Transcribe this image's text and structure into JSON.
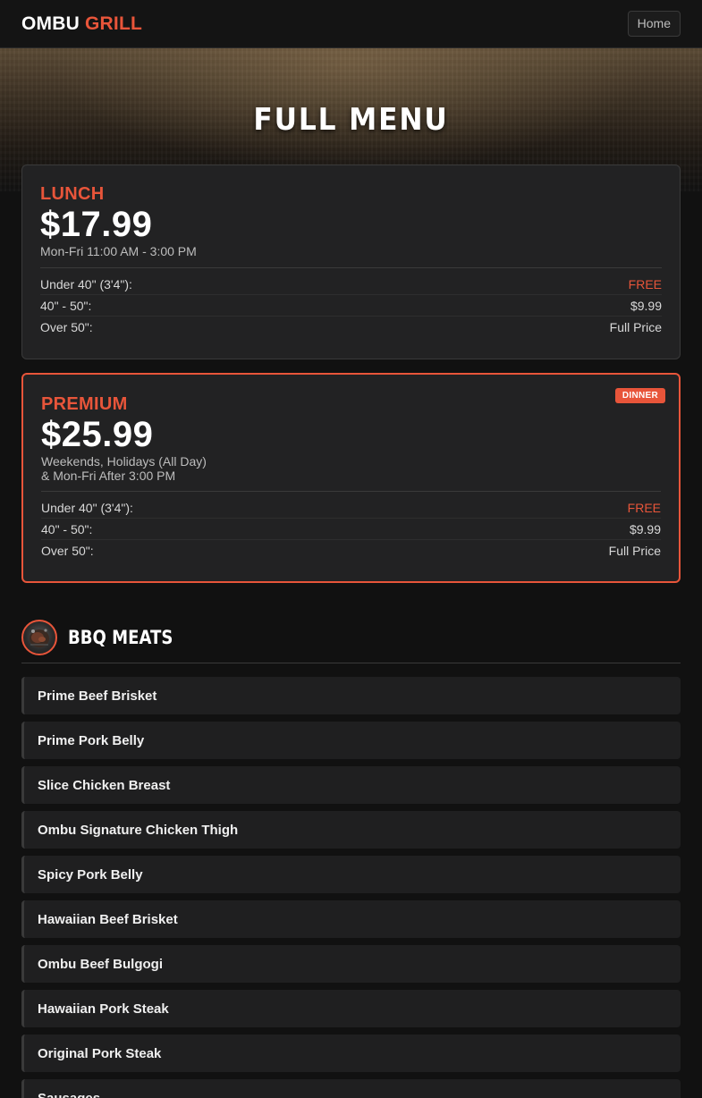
{
  "header": {
    "brand_main": "OMBU",
    "brand_accent": "GRILL",
    "home_label": "Home"
  },
  "hero": {
    "title": "FULL MENU"
  },
  "pricing": {
    "lunch": {
      "label": "LUNCH",
      "price": "$17.99",
      "hours": "Mon-Fri 11:00 AM - 3:00 PM",
      "rows": [
        {
          "label": "Under 40\" (3'4\"):",
          "value": "FREE"
        },
        {
          "label": "40\" - 50\":",
          "value": "$9.99"
        },
        {
          "label": "Over 50\":",
          "value": "Full Price"
        }
      ]
    },
    "premium": {
      "label": "PREMIUM",
      "badge": "DINNER",
      "price": "$25.99",
      "hours_line1": "Weekends, Holidays (All Day)",
      "hours_line2": "& Mon-Fri After 3:00 PM",
      "rows": [
        {
          "label": "Under 40\" (3'4\"):",
          "value": "FREE"
        },
        {
          "label": "40\" - 50\":",
          "value": "$9.99"
        },
        {
          "label": "Over 50\":",
          "value": "Full Price"
        }
      ]
    }
  },
  "section": {
    "icon": "bbq-meat-icon",
    "title": "BBQ MEATS",
    "items": [
      "Prime Beef Brisket",
      "Prime Pork Belly",
      "Slice Chicken Breast",
      "Ombu Signature Chicken Thigh",
      "Spicy Pork Belly",
      "Hawaiian Beef Brisket",
      "Ombu Beef Bulgogi",
      "Hawaiian Pork Steak",
      "Original Pork Steak",
      "Sausages"
    ]
  },
  "colors": {
    "accent": "#e8553a",
    "background": "#111111",
    "card": "#222223"
  }
}
